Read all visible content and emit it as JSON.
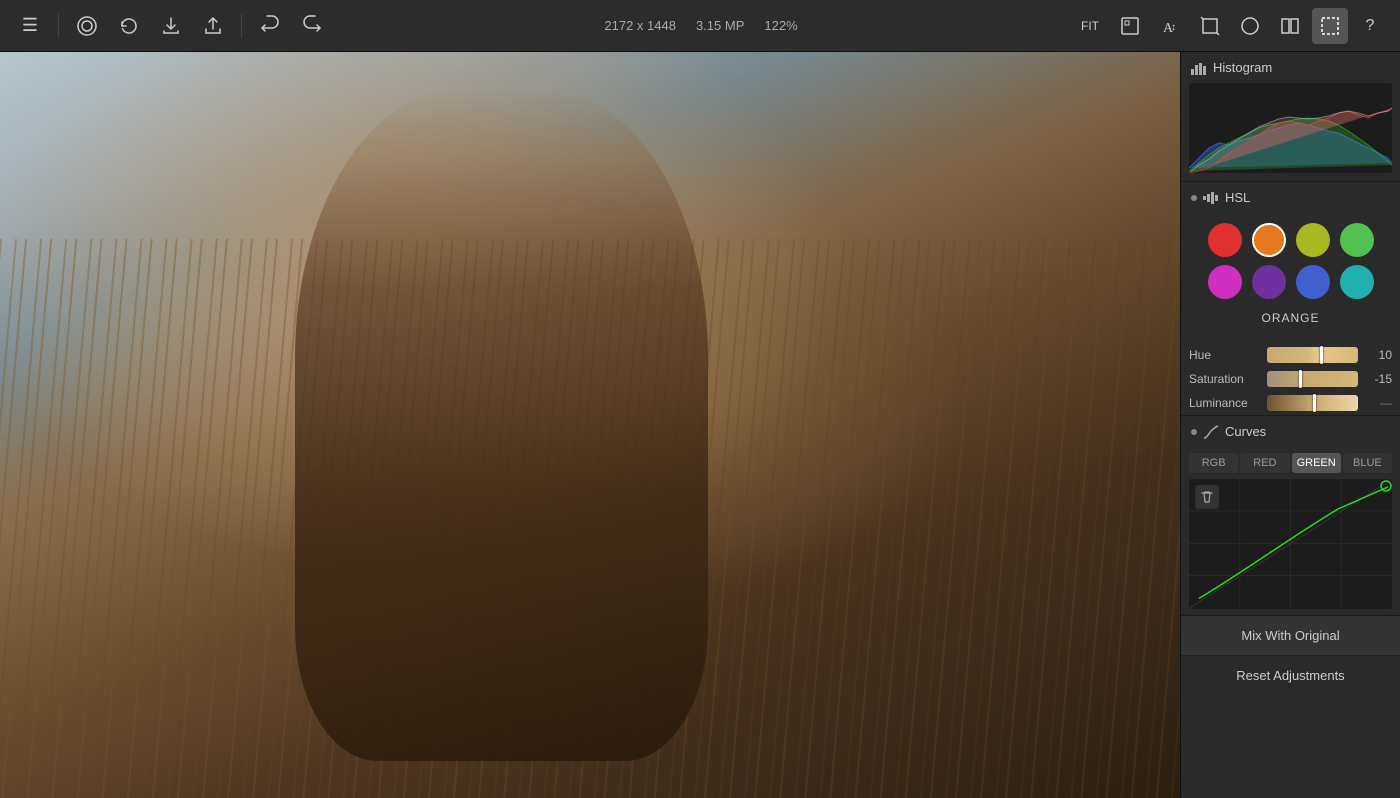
{
  "toolbar": {
    "menu_icon": "☰",
    "stamp_icon": "◎",
    "history_icon": "↺",
    "download_icon": "⬇",
    "share_icon": "⬆",
    "undo_icon": "←",
    "redo_icon": "→",
    "image_info": {
      "dimensions": "2172 x 1448",
      "megapixels": "3.15 MP",
      "zoom": "122%"
    },
    "fit_label": "FIT",
    "tools": [
      "FIT",
      "⊞",
      "A↕",
      "⊡",
      "○",
      "⊟",
      "⬚",
      "?"
    ]
  },
  "histogram": {
    "title": "Histogram"
  },
  "hsl": {
    "title": "HSL",
    "colors": [
      {
        "name": "red",
        "hex": "#e03030",
        "active": false
      },
      {
        "name": "orange",
        "hex": "#e87820",
        "active": true
      },
      {
        "name": "yellow-green",
        "hex": "#a8b820",
        "active": false
      },
      {
        "name": "green",
        "hex": "#50c050",
        "active": false
      },
      {
        "name": "magenta",
        "hex": "#d030c0",
        "active": false
      },
      {
        "name": "purple",
        "hex": "#7030a0",
        "active": false
      },
      {
        "name": "blue",
        "hex": "#4060d0",
        "active": false
      },
      {
        "name": "teal",
        "hex": "#20b0b0",
        "active": false
      }
    ],
    "selected_label": "ORANGE",
    "sliders": {
      "hue": {
        "label": "Hue",
        "value": 10,
        "percent": 58
      },
      "saturation": {
        "label": "Saturation",
        "value": -15,
        "percent": 35
      },
      "luminance": {
        "label": "Luminance",
        "value": 0,
        "percent": 50
      }
    }
  },
  "curves": {
    "title": "Curves",
    "tabs": [
      "RGB",
      "RED",
      "GREEN",
      "BLUE"
    ],
    "active_tab": "GREEN"
  },
  "bottom": {
    "mix_label": "Mix With Original",
    "reset_label": "Reset Adjustments"
  }
}
